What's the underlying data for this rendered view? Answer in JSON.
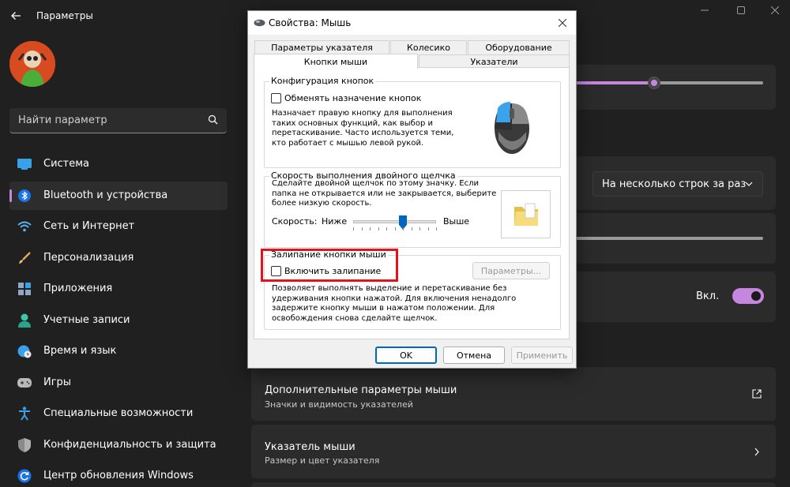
{
  "app": {
    "title": "Параметры"
  },
  "search": {
    "placeholder": "Найти параметр"
  },
  "nav": {
    "items": [
      {
        "label": "Система",
        "icon": "display-icon"
      },
      {
        "label": "Bluetooth и устройства",
        "icon": "bluetooth-icon"
      },
      {
        "label": "Сеть и Интернет",
        "icon": "wifi-icon"
      },
      {
        "label": "Персонализация",
        "icon": "brush-icon"
      },
      {
        "label": "Приложения",
        "icon": "apps-icon"
      },
      {
        "label": "Учетные записи",
        "icon": "person-icon"
      },
      {
        "label": "Время и язык",
        "icon": "globe-clock-icon"
      },
      {
        "label": "Игры",
        "icon": "gamepad-icon"
      },
      {
        "label": "Специальные возможности",
        "icon": "accessibility-icon"
      },
      {
        "label": "Конфиденциальность и защита",
        "icon": "shield-icon"
      },
      {
        "label": "Центр обновления Windows",
        "icon": "update-icon"
      }
    ],
    "active_index": 1
  },
  "main": {
    "scroll_dropdown_value": "На несколько строк за раз",
    "toggle_label": "Вкл.",
    "additional_mouse": {
      "title": "Дополнительные параметры мыши",
      "subtitle": "Значки и видимость указателей"
    },
    "pointer": {
      "title": "Указатель мыши",
      "subtitle": "Размер и цвет указателя"
    }
  },
  "dialog": {
    "title": "Свойства: Мышь",
    "tabs_top": [
      "Параметры указателя",
      "Колесико",
      "Оборудование"
    ],
    "tabs_bottom": [
      "Кнопки мыши",
      "Указатели"
    ],
    "active_tab": "Кнопки мыши",
    "button_config": {
      "title": "Конфигурация кнопок",
      "checkbox_label": "Обменять назначение кнопок",
      "checked": false,
      "description": "Назначает правую кнопку для выполнения таких основных функций, как выбор и перетаскивание. Часто используется теми, кто работает с мышью левой рукой."
    },
    "double_click": {
      "title": "Скорость выполнения двойного щелчка",
      "description": "Сделайте двойной щелчок по этому значку. Если папка не открывается или не закрывается, выберите более низкую скорость.",
      "speed_label": "Скорость:",
      "low_label": "Ниже",
      "high_label": "Выше",
      "speed_fraction": 0.6
    },
    "click_lock": {
      "title": "Залипание кнопки мыши",
      "checkbox_label": "Включить залипание",
      "checked": false,
      "settings_button": "Параметры...",
      "description": "Позволяет выполнять выделение и перетаскивание без удерживания кнопки нажатой. Для включения ненадолго задержите кнопку мыши в нажатом положении. Для освобождения снова сделайте щелчок."
    },
    "buttons": {
      "ok": "OK",
      "cancel": "Отмена",
      "apply": "Применить"
    }
  },
  "colors": {
    "accent": "#c586e0",
    "dialog_accent": "#0067c0",
    "highlight": "#e3141d"
  }
}
